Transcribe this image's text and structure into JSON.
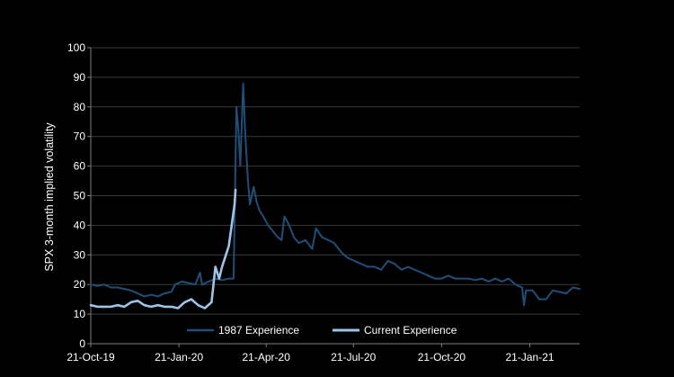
{
  "chart_data": {
    "type": "line",
    "title": "",
    "ylabel": "SPX 3-month  implied volatility",
    "xlabel": "",
    "ylim": [
      0,
      100
    ],
    "yticks": [
      0,
      10,
      20,
      30,
      40,
      50,
      60,
      70,
      80,
      90,
      100
    ],
    "xticks": [
      "21-Oct-19",
      "21-Jan-20",
      "21-Apr-20",
      "21-Jul-20",
      "21-Oct-20",
      "21-Jan-21"
    ],
    "xrange": [
      "21-Oct-19",
      "14-Mar-21"
    ],
    "grid": "horizontal",
    "legend_position": "bottom-center",
    "series": [
      {
        "name": "1987 Experience",
        "color": "#1f4e79",
        "points": [
          [
            "21-Oct-19",
            20
          ],
          [
            "28-Oct-19",
            19.5
          ],
          [
            "4-Nov-19",
            20
          ],
          [
            "11-Nov-19",
            19
          ],
          [
            "18-Nov-19",
            19
          ],
          [
            "25-Nov-19",
            18.5
          ],
          [
            "2-Dec-19",
            18
          ],
          [
            "9-Dec-19",
            17
          ],
          [
            "16-Dec-19",
            16
          ],
          [
            "23-Dec-19",
            16.5
          ],
          [
            "30-Dec-19",
            16
          ],
          [
            "6-Jan-20",
            17
          ],
          [
            "13-Jan-20",
            17.5
          ],
          [
            "17-Jan-20",
            20
          ],
          [
            "24-Jan-20",
            21
          ],
          [
            "31-Jan-20",
            20.5
          ],
          [
            "7-Feb-20",
            20
          ],
          [
            "12-Feb-20",
            24
          ],
          [
            "14-Feb-20",
            20
          ],
          [
            "21-Feb-20",
            21
          ],
          [
            "28-Feb-20",
            22
          ],
          [
            "6-Mar-20",
            21.5
          ],
          [
            "13-Mar-20",
            22
          ],
          [
            "18-Mar-20",
            22
          ],
          [
            "21-Mar-20",
            80
          ],
          [
            "23-Mar-20",
            72
          ],
          [
            "25-Mar-20",
            60
          ],
          [
            "28-Mar-20",
            88
          ],
          [
            "30-Mar-20",
            72
          ],
          [
            "2-Apr-20",
            55
          ],
          [
            "4-Apr-20",
            47
          ],
          [
            "6-Apr-20",
            50
          ],
          [
            "8-Apr-20",
            53
          ],
          [
            "11-Apr-20",
            48
          ],
          [
            "14-Apr-20",
            45
          ],
          [
            "18-Apr-20",
            43
          ],
          [
            "23-Apr-20",
            40
          ],
          [
            "28-Apr-20",
            38
          ],
          [
            "3-May-20",
            36
          ],
          [
            "7-May-20",
            35
          ],
          [
            "10-May-20",
            43
          ],
          [
            "15-May-20",
            40
          ],
          [
            "20-May-20",
            36
          ],
          [
            "25-May-20",
            34
          ],
          [
            "1-Jun-20",
            35
          ],
          [
            "8-Jun-20",
            32
          ],
          [
            "12-Jun-20",
            39
          ],
          [
            "18-Jun-20",
            36
          ],
          [
            "25-Jun-20",
            35
          ],
          [
            "1-Jul-20",
            34
          ],
          [
            "8-Jul-20",
            31
          ],
          [
            "15-Jul-20",
            29
          ],
          [
            "22-Jul-20",
            28
          ],
          [
            "29-Jul-20",
            27
          ],
          [
            "5-Aug-20",
            26
          ],
          [
            "12-Aug-20",
            26
          ],
          [
            "19-Aug-20",
            25
          ],
          [
            "26-Aug-20",
            28
          ],
          [
            "2-Sep-20",
            27
          ],
          [
            "9-Sep-20",
            25
          ],
          [
            "16-Sep-20",
            26
          ],
          [
            "23-Sep-20",
            25
          ],
          [
            "30-Sep-20",
            24
          ],
          [
            "7-Oct-20",
            23
          ],
          [
            "14-Oct-20",
            22
          ],
          [
            "21-Oct-20",
            22
          ],
          [
            "28-Oct-20",
            23
          ],
          [
            "4-Nov-20",
            22
          ],
          [
            "11-Nov-20",
            22
          ],
          [
            "18-Nov-20",
            22
          ],
          [
            "25-Nov-20",
            21.5
          ],
          [
            "2-Dec-20",
            22
          ],
          [
            "9-Dec-20",
            21
          ],
          [
            "16-Dec-20",
            22
          ],
          [
            "23-Dec-20",
            21
          ],
          [
            "30-Dec-20",
            22
          ],
          [
            "6-Jan-21",
            20
          ],
          [
            "13-Jan-21",
            19
          ],
          [
            "15-Jan-21",
            13
          ],
          [
            "17-Jan-21",
            18
          ],
          [
            "24-Jan-21",
            18
          ],
          [
            "31-Jan-21",
            15
          ],
          [
            "7-Feb-21",
            15
          ],
          [
            "14-Feb-21",
            18
          ],
          [
            "21-Feb-21",
            17.5
          ],
          [
            "28-Feb-21",
            17
          ],
          [
            "7-Mar-21",
            19
          ],
          [
            "14-Mar-21",
            18.5
          ]
        ]
      },
      {
        "name": "Current Experience",
        "color": "#9dc3e6",
        "points": [
          [
            "21-Oct-19",
            13
          ],
          [
            "28-Oct-19",
            12.5
          ],
          [
            "4-Nov-19",
            12.5
          ],
          [
            "11-Nov-19",
            12.5
          ],
          [
            "18-Nov-19",
            13
          ],
          [
            "25-Nov-19",
            12.5
          ],
          [
            "2-Dec-19",
            14
          ],
          [
            "9-Dec-19",
            14.5
          ],
          [
            "16-Dec-19",
            13
          ],
          [
            "23-Dec-19",
            12.5
          ],
          [
            "30-Dec-19",
            13
          ],
          [
            "6-Jan-20",
            12.5
          ],
          [
            "13-Jan-20",
            12.5
          ],
          [
            "20-Jan-20",
            12
          ],
          [
            "27-Jan-20",
            14
          ],
          [
            "3-Feb-20",
            15
          ],
          [
            "10-Feb-20",
            13
          ],
          [
            "17-Feb-20",
            12
          ],
          [
            "24-Feb-20",
            14
          ],
          [
            "28-Feb-20",
            26
          ],
          [
            "3-Mar-20",
            22
          ],
          [
            "6-Mar-20",
            26
          ],
          [
            "10-Mar-20",
            30
          ],
          [
            "13-Mar-20",
            33
          ],
          [
            "16-Mar-20",
            40
          ],
          [
            "19-Mar-20",
            47
          ],
          [
            "20-Mar-20",
            52
          ]
        ]
      }
    ]
  }
}
